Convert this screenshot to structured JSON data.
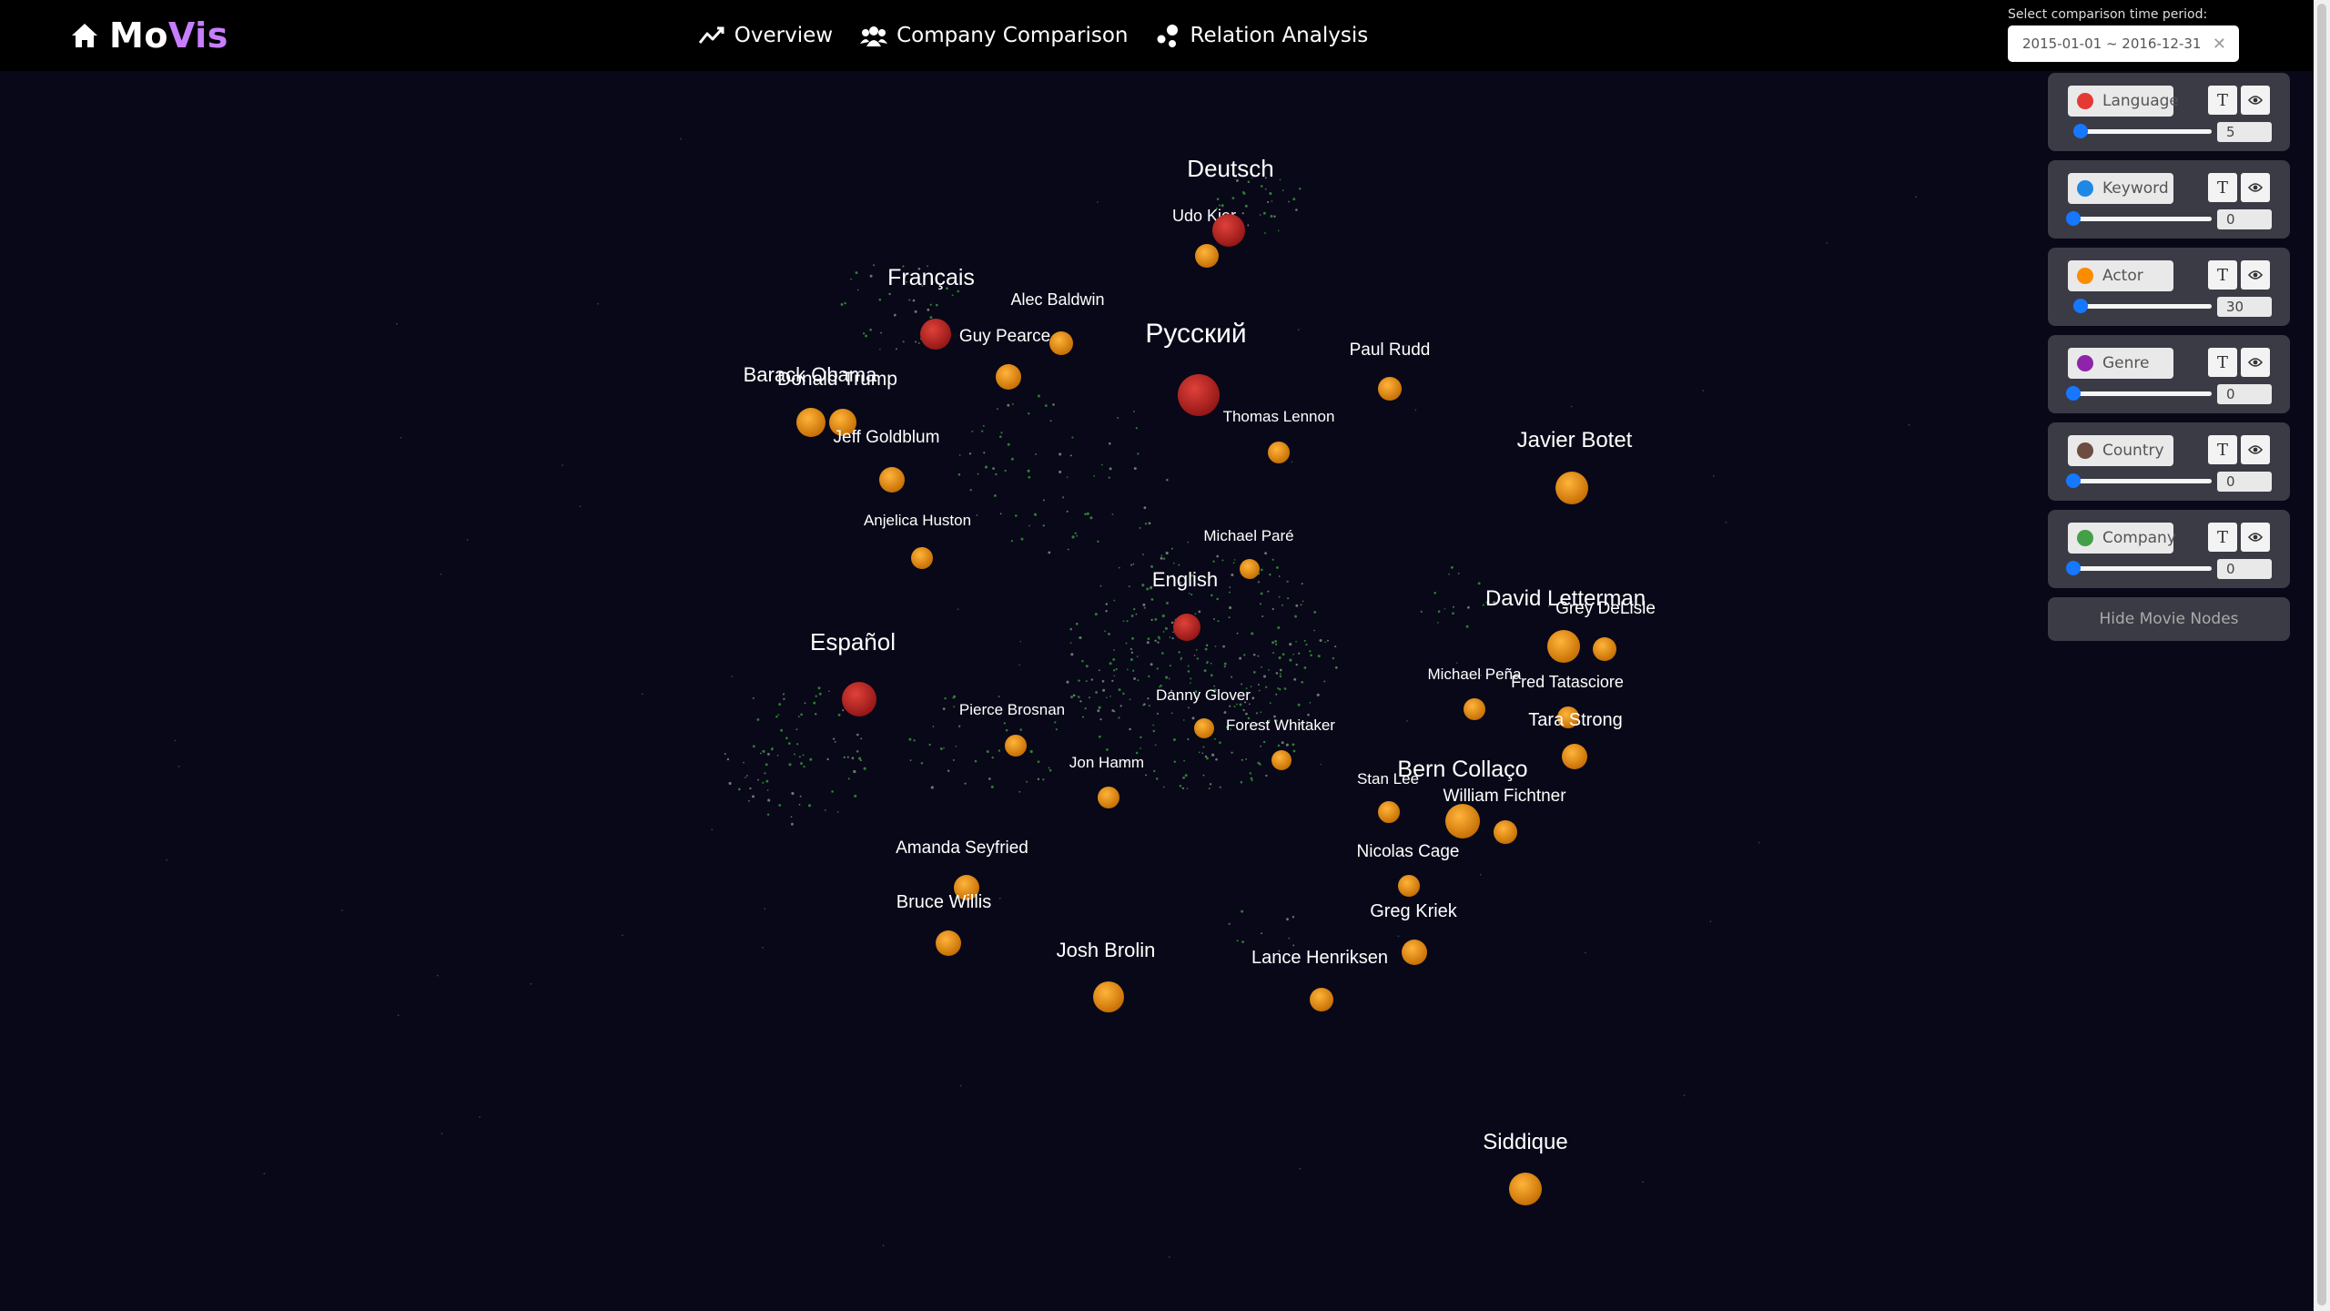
{
  "app": {
    "logo_mo": "Mo",
    "logo_vis": "Vis"
  },
  "nav": [
    {
      "label": "Overview",
      "icon": "line-chart-icon"
    },
    {
      "label": "Company Comparison",
      "icon": "team-icon"
    },
    {
      "label": "Relation Analysis",
      "icon": "relation-icon"
    }
  ],
  "period": {
    "label": "Select comparison time period:",
    "value": "2015-01-01 ~ 2016-12-31",
    "clear": "✕"
  },
  "filters": [
    {
      "label": "Language",
      "color": "#e53935",
      "value": "5",
      "level": 0.05
    },
    {
      "label": "Keyword",
      "color": "#1e88e5",
      "value": "0",
      "level": 0
    },
    {
      "label": "Actor",
      "color": "#fb8c00",
      "value": "30",
      "level": 0.05
    },
    {
      "label": "Genre",
      "color": "#8e24aa",
      "value": "0",
      "level": 0
    },
    {
      "label": "Country",
      "color": "#6d4c41",
      "value": "0",
      "level": 0
    },
    {
      "label": "Company",
      "color": "#43a047",
      "value": "0",
      "level": 0
    }
  ],
  "filter_button_t": "T",
  "hide_button": "Hide Movie Nodes",
  "graph": {
    "language_color": "#c62828",
    "actor_color": "#f29a0c",
    "languages": [
      "Deutsch",
      "Français",
      "Русский",
      "English",
      "Español"
    ],
    "actors": [
      "Udo Kier",
      "Alec Baldwin",
      "Guy Pearce",
      "Paul Rudd",
      "Barack Obama",
      "Donald Trump",
      "Thomas Lennon",
      "Jeff Goldblum",
      "Javier Botet",
      "Anjelica Huston",
      "Michael Paré",
      "David Letterman",
      "Grey DeLisle",
      "Michael Peña",
      "Fred Tatasciore",
      "Tara Strong",
      "Pierce Brosnan",
      "Danny Glover",
      "Forest Whitaker",
      "Jon Hamm",
      "Stan Lee",
      "Bern Collaço",
      "William Fichtner",
      "Amanda Seyfried",
      "Nicolas Cage",
      "Bruce Willis",
      "Greg Kriek",
      "Josh Brolin",
      "Lance Henriksen",
      "Siddique"
    ]
  }
}
